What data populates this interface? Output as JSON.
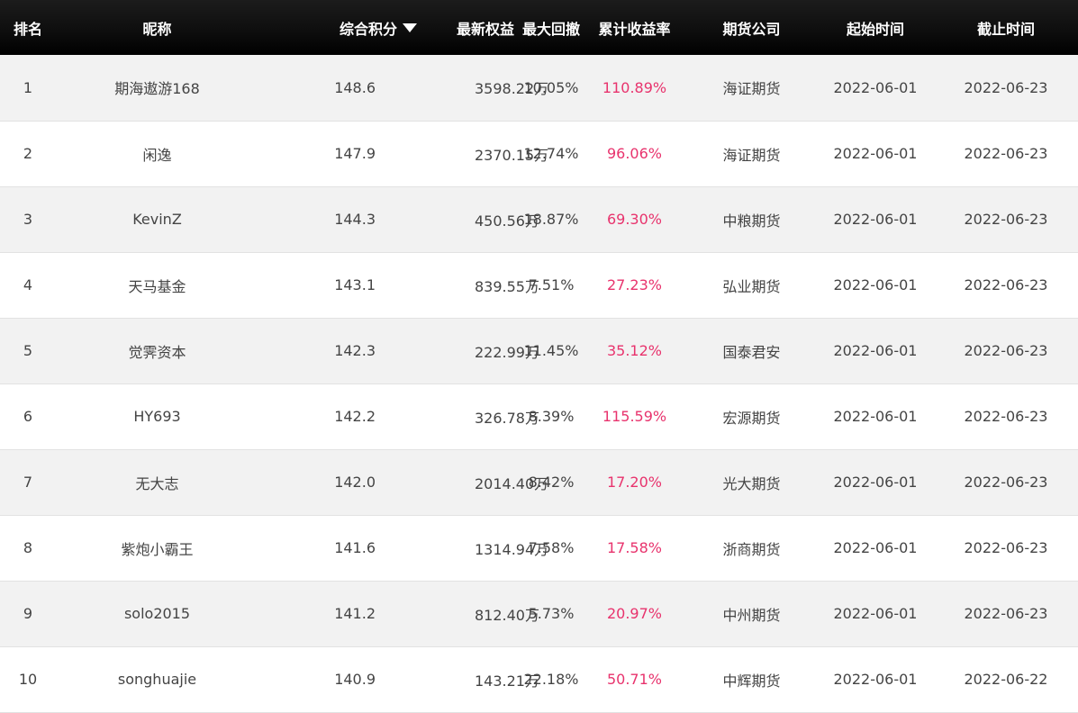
{
  "colors": {
    "header_bg": "#000000",
    "header_text": "#ffffff",
    "return_text": "#e8336d",
    "row_alt": "#f2f2f2"
  },
  "header": {
    "rank": "排名",
    "nickname": "昵称",
    "score": "综合积分",
    "score_sort_icon": "sort-desc-icon",
    "equity": "最新权益",
    "drawdown": "最大回撤",
    "return": "累计收益率",
    "company": "期货公司",
    "start": "起始时间",
    "end": "截止时间"
  },
  "rows": [
    {
      "rank": "1",
      "nickname": "期海遨游168",
      "score": "148.6",
      "equity": "3598.22万",
      "drawdown": "10.05%",
      "return": "110.89%",
      "company": "海证期货",
      "start": "2022-06-01",
      "end": "2022-06-23"
    },
    {
      "rank": "2",
      "nickname": "闲逸",
      "score": "147.9",
      "equity": "2370.15万",
      "drawdown": "12.74%",
      "return": "96.06%",
      "company": "海证期货",
      "start": "2022-06-01",
      "end": "2022-06-23"
    },
    {
      "rank": "3",
      "nickname": "KevinZ",
      "score": "144.3",
      "equity": "450.56万",
      "drawdown": "18.87%",
      "return": "69.30%",
      "company": "中粮期货",
      "start": "2022-06-01",
      "end": "2022-06-23"
    },
    {
      "rank": "4",
      "nickname": "天马基金",
      "score": "143.1",
      "equity": "839.55万",
      "drawdown": "7.51%",
      "return": "27.23%",
      "company": "弘业期货",
      "start": "2022-06-01",
      "end": "2022-06-23"
    },
    {
      "rank": "5",
      "nickname": "觉霁资本",
      "score": "142.3",
      "equity": "222.99万",
      "drawdown": "11.45%",
      "return": "35.12%",
      "company": "国泰君安",
      "start": "2022-06-01",
      "end": "2022-06-23"
    },
    {
      "rank": "6",
      "nickname": "HY693",
      "score": "142.2",
      "equity": "326.78万",
      "drawdown": "8.39%",
      "return": "115.59%",
      "company": "宏源期货",
      "start": "2022-06-01",
      "end": "2022-06-23"
    },
    {
      "rank": "7",
      "nickname": "无大志",
      "score": "142.0",
      "equity": "2014.40万",
      "drawdown": "8.42%",
      "return": "17.20%",
      "company": "光大期货",
      "start": "2022-06-01",
      "end": "2022-06-23"
    },
    {
      "rank": "8",
      "nickname": "紫炮小霸王",
      "score": "141.6",
      "equity": "1314.94万",
      "drawdown": "7.58%",
      "return": "17.58%",
      "company": "浙商期货",
      "start": "2022-06-01",
      "end": "2022-06-23"
    },
    {
      "rank": "9",
      "nickname": "solo2015",
      "score": "141.2",
      "equity": "812.40万",
      "drawdown": "5.73%",
      "return": "20.97%",
      "company": "中州期货",
      "start": "2022-06-01",
      "end": "2022-06-23"
    },
    {
      "rank": "10",
      "nickname": "songhuajie",
      "score": "140.9",
      "equity": "143.21万",
      "drawdown": "22.18%",
      "return": "50.71%",
      "company": "中辉期货",
      "start": "2022-06-01",
      "end": "2022-06-22"
    }
  ]
}
